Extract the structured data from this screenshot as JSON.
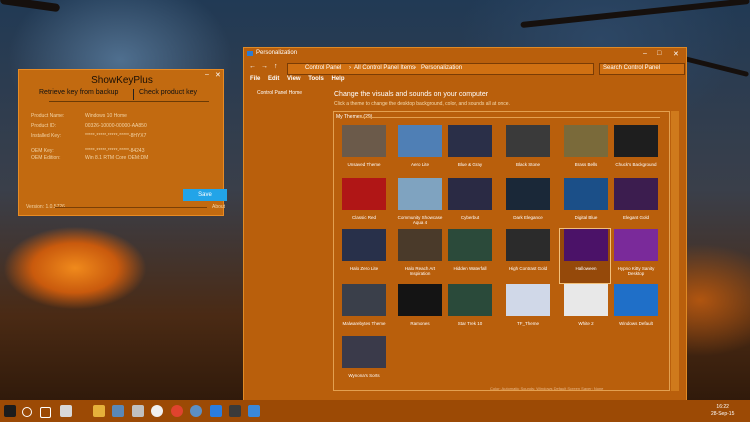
{
  "showkeyplus": {
    "title": "ShowKeyPlus",
    "minimize": "–",
    "close": "✕",
    "tab_backup": "Retrieve key from backup",
    "tab_check": "Check product key",
    "rows": [
      {
        "label": "Product  Name:",
        "value": "Windows 10 Home"
      },
      {
        "label": "Product  ID:",
        "value": "00326-10000-00000-AA850"
      },
      {
        "label": "Installed Key:",
        "value": "*****-*****-*****-*****-8HYX7"
      },
      {
        "label": "OEM Key:",
        "value": "*****-*****-*****-*****-84243"
      },
      {
        "label": "OEM Edition:",
        "value": "Win 8.1 RTM Core OEM:DM"
      }
    ],
    "save": "Save",
    "version": "Version: 1.0.5726",
    "about": "About"
  },
  "personalization": {
    "title": "Personalization",
    "win_min": "–",
    "win_max": "□",
    "win_close": "✕",
    "nav_back": "←",
    "nav_forward": "→",
    "nav_up": "↑",
    "breadcrumb": [
      "Control Panel",
      "All Control Panel Items",
      "Personalization"
    ],
    "sep": "›",
    "search_placeholder": "Search Control Panel",
    "menu": [
      "File",
      "Edit",
      "View",
      "Tools",
      "Help"
    ],
    "cp_home": "Control Panel Home",
    "heading": "Change the visuals and sounds on your computer",
    "subheading": "Click a theme to change the desktop background, color, and sounds all at once.",
    "group_label": "My Themes (29)",
    "themes": [
      {
        "name": "Unsaved Theme",
        "color": "#6b5a4a"
      },
      {
        "name": "Aero Lite",
        "color": "#4f7fb5"
      },
      {
        "name": "Blue & Gray",
        "color": "#2a2f48"
      },
      {
        "name": "Black Stone",
        "color": "#3a3a3a"
      },
      {
        "name": "Brass Bells",
        "color": "#7a6a3a"
      },
      {
        "name": "Chuck's Background",
        "color": "#1e1e1e"
      },
      {
        "name": "Classic Red",
        "color": "#b01616"
      },
      {
        "name": "Community Showcase Aqua 4",
        "color": "#7fa3c0"
      },
      {
        "name": "Cyberbut",
        "color": "#2a2a44"
      },
      {
        "name": "Dark Elegance",
        "color": "#1a2838"
      },
      {
        "name": "Digital Blue",
        "color": "#1b4f88"
      },
      {
        "name": "Elegant Gold",
        "color": "#3c1d4f"
      },
      {
        "name": "Halo Zero Lite",
        "color": "#28304a"
      },
      {
        "name": "Halo Reach Art Inspiration",
        "color": "#4a3a2a"
      },
      {
        "name": "Hidden Waterfall",
        "color": "#2b4a3a"
      },
      {
        "name": "High Contrast Gold",
        "color": "#2b2b2b"
      },
      {
        "name": "Halloween",
        "color": "#4b1268"
      },
      {
        "name": "Hypno Kitty Sanity Desktop",
        "color": "#7a2a9a"
      },
      {
        "name": "Malwarebytes Theme",
        "color": "#3a3f4a"
      },
      {
        "name": "Ramones",
        "color": "#141414"
      },
      {
        "name": "Star Trek 10",
        "color": "#2a4a3a"
      },
      {
        "name": "TF_Theme",
        "color": "#d0d8e8"
      },
      {
        "name": "White 2",
        "color": "#e8e8e8"
      },
      {
        "name": "Windows Default",
        "color": "#1f6fc8"
      },
      {
        "name": "Wynona's Sorts",
        "color": "#3a3a4a"
      }
    ],
    "selected_theme": "Halloween",
    "footer_a": "Desktop Background",
    "footer_b": "Color: Automatic   Sounds: Windows Default   Screen Saver: None"
  },
  "taskbar": {
    "time": "16:22",
    "date": "28-Sep-15"
  }
}
